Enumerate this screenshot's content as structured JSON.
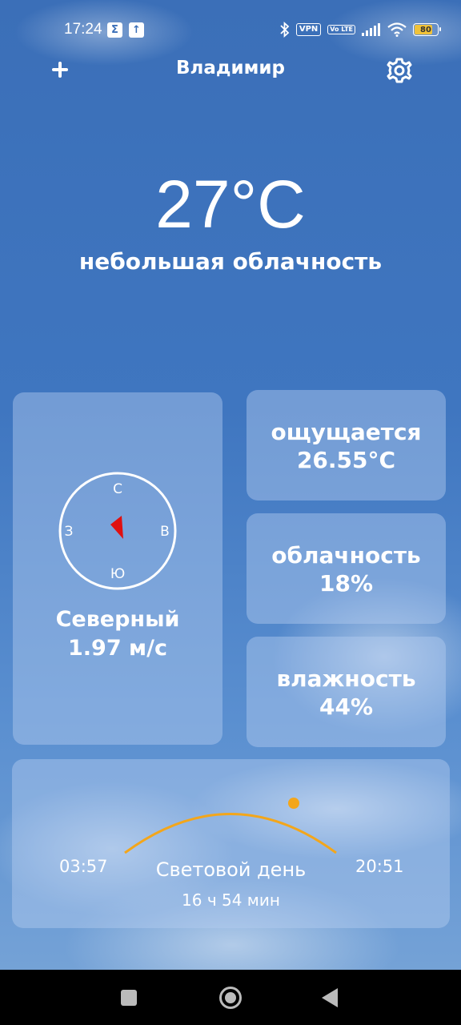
{
  "status_bar": {
    "time": "17:24",
    "vpn_label": "VPN",
    "volte_label": "Vo LTE",
    "battery_level": "80"
  },
  "header": {
    "city": "Владимир"
  },
  "current": {
    "temperature": "27°C",
    "description": "небольшая облачность"
  },
  "wind": {
    "compass": {
      "north": "С",
      "east": "В",
      "south": "Ю",
      "west": "З"
    },
    "direction": "Северный",
    "speed": "1.97 м/с"
  },
  "feels_like": {
    "label": "ощущается",
    "value": "26.55°C"
  },
  "cloudiness": {
    "label": "облачность",
    "value": "18%"
  },
  "humidity": {
    "label": "влажность",
    "value": "44%"
  },
  "daylight": {
    "sunrise": "03:57",
    "sunset": "20:51",
    "label": "Световой день",
    "duration": "16 ч 54 мин"
  },
  "colors": {
    "sun": "#f3a61b",
    "arrow": "#e01010",
    "battery_fill": "#f0c23a"
  }
}
